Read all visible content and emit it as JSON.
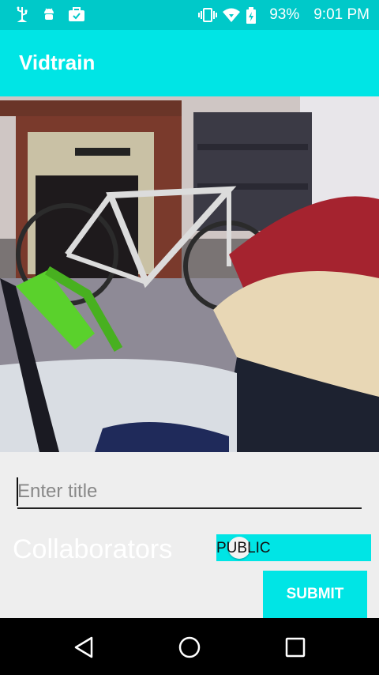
{
  "status_bar": {
    "battery": "93%",
    "time": "9:01 PM",
    "icons": [
      "usb-icon",
      "android-debug-icon",
      "briefcase-check-icon",
      "vibrate-icon",
      "wifi-icon",
      "battery-charging-icon"
    ]
  },
  "app_bar": {
    "title": "Vidtrain"
  },
  "video": {
    "icon": "video-preview"
  },
  "form": {
    "title_placeholder": "Enter title",
    "title_value": "",
    "collaborators_label": "Collaborators",
    "visibility_label": "PUBLIC",
    "submit_label": "SUBMIT"
  },
  "nav_bar": {
    "icons": [
      "back-icon",
      "home-icon",
      "recents-icon"
    ]
  },
  "colors": {
    "accent": "#00e5e5",
    "status_bar": "#00c9c9",
    "nav_bar": "#000000",
    "background": "#eeeeee"
  }
}
